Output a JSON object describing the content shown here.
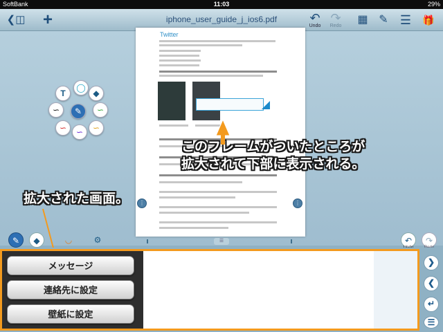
{
  "status_bar": {
    "carrier": "SoftBank",
    "time": "11:03",
    "battery": "29%"
  },
  "toolbar": {
    "title": "iphone_user_guide_j_ios6.pdf",
    "undo_label": "Undo",
    "redo_label": "Redo"
  },
  "document": {
    "heading": "Twitter"
  },
  "annotations": {
    "frame_note_line1": "このフレームがついたところが",
    "frame_note_line2": "拡大されて下部に表示される。",
    "zoom_note": "拡大された画面。"
  },
  "lower_toolbar": {
    "undo_label": "Undo",
    "redo_label": "Redo"
  },
  "zoom_view": {
    "buttons": [
      "メッセージ",
      "連絡先に設定",
      "壁紙に設定"
    ]
  },
  "colors": {
    "accent": "#f39a1e",
    "frame_blue": "#1b8acb",
    "link_blue": "#2e8fc7"
  }
}
